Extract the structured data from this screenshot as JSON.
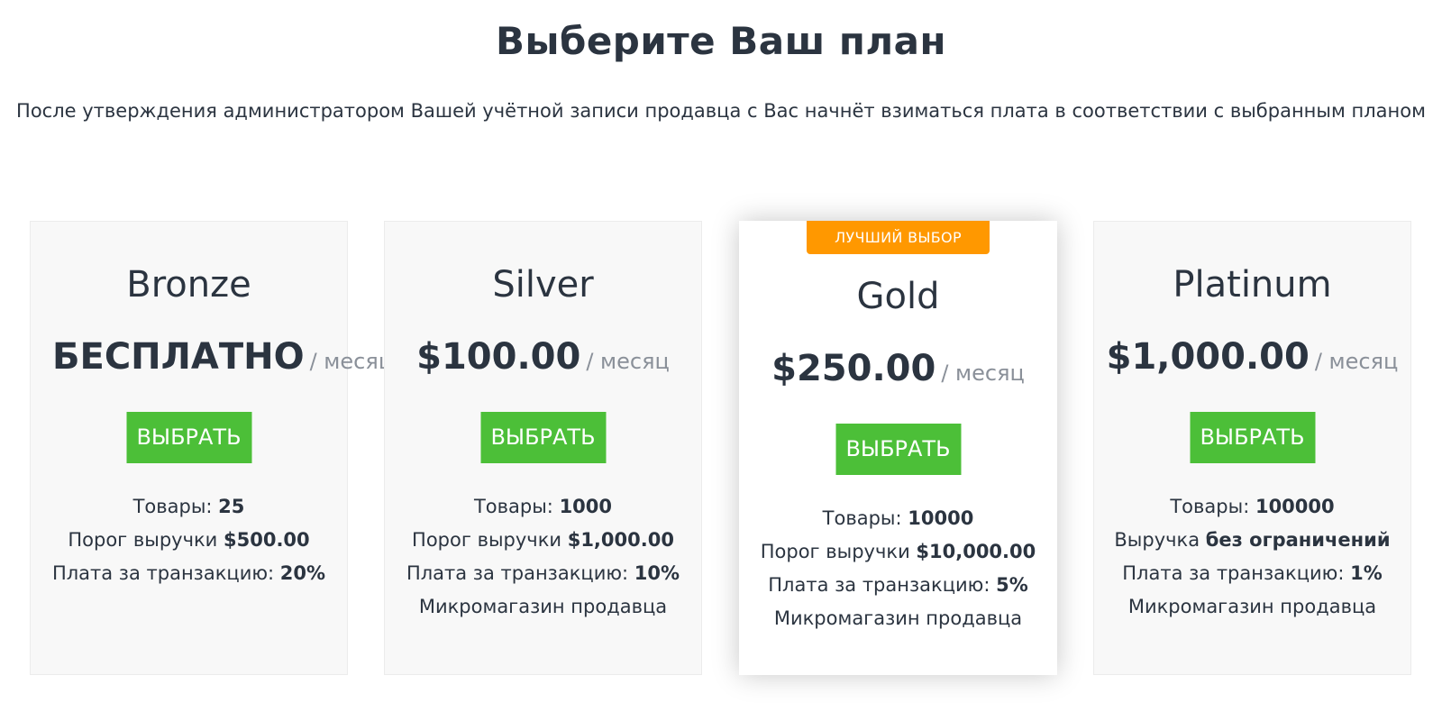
{
  "header": {
    "title": "Выберите Ваш план",
    "subtitle": "После утверждения администратором Вашей учётной записи продавца с Вас начнёт взиматься плата в соответствии с выбранным планом"
  },
  "colors": {
    "accent_button": "#4cbf38",
    "badge": "#ff9800",
    "text": "#2b3440",
    "muted": "#8a9099"
  },
  "plans": [
    {
      "name": "Bronze",
      "price": "БЕСПЛАТНО",
      "period": "/ месяц",
      "button_label": "ВЫБРАТЬ",
      "features": [
        {
          "label": "Товары: ",
          "value": "25"
        },
        {
          "label": "Порог выручки ",
          "value": "$500.00"
        },
        {
          "label": "Плата за транзакцию: ",
          "value": "20%"
        }
      ]
    },
    {
      "name": "Silver",
      "price": "$100.00",
      "period": "/ месяц",
      "button_label": "ВЫБРАТЬ",
      "features": [
        {
          "label": "Товары: ",
          "value": "1000"
        },
        {
          "label": "Порог выручки ",
          "value": "$1,000.00"
        },
        {
          "label": "Плата за транзакцию: ",
          "value": "10%"
        },
        {
          "label": "Микромагазин продавца",
          "value": ""
        }
      ]
    },
    {
      "name": "Gold",
      "badge": "ЛУЧШИЙ ВЫБОР",
      "price": "$250.00",
      "period": "/ месяц",
      "button_label": "ВЫБРАТЬ",
      "features": [
        {
          "label": "Товары: ",
          "value": "10000"
        },
        {
          "label": "Порог выручки ",
          "value": "$10,000.00"
        },
        {
          "label": "Плата за транзакцию: ",
          "value": "5%"
        },
        {
          "label": "Микромагазин продавца",
          "value": ""
        }
      ]
    },
    {
      "name": "Platinum",
      "price": "$1,000.00",
      "period": "/ месяц",
      "button_label": "ВЫБРАТЬ",
      "features": [
        {
          "label": "Товары: ",
          "value": "100000"
        },
        {
          "label": "Выручка ",
          "value": "без ограничений"
        },
        {
          "label": "Плата за транзакцию: ",
          "value": "1%"
        },
        {
          "label": "Микромагазин продавца",
          "value": ""
        }
      ]
    }
  ]
}
